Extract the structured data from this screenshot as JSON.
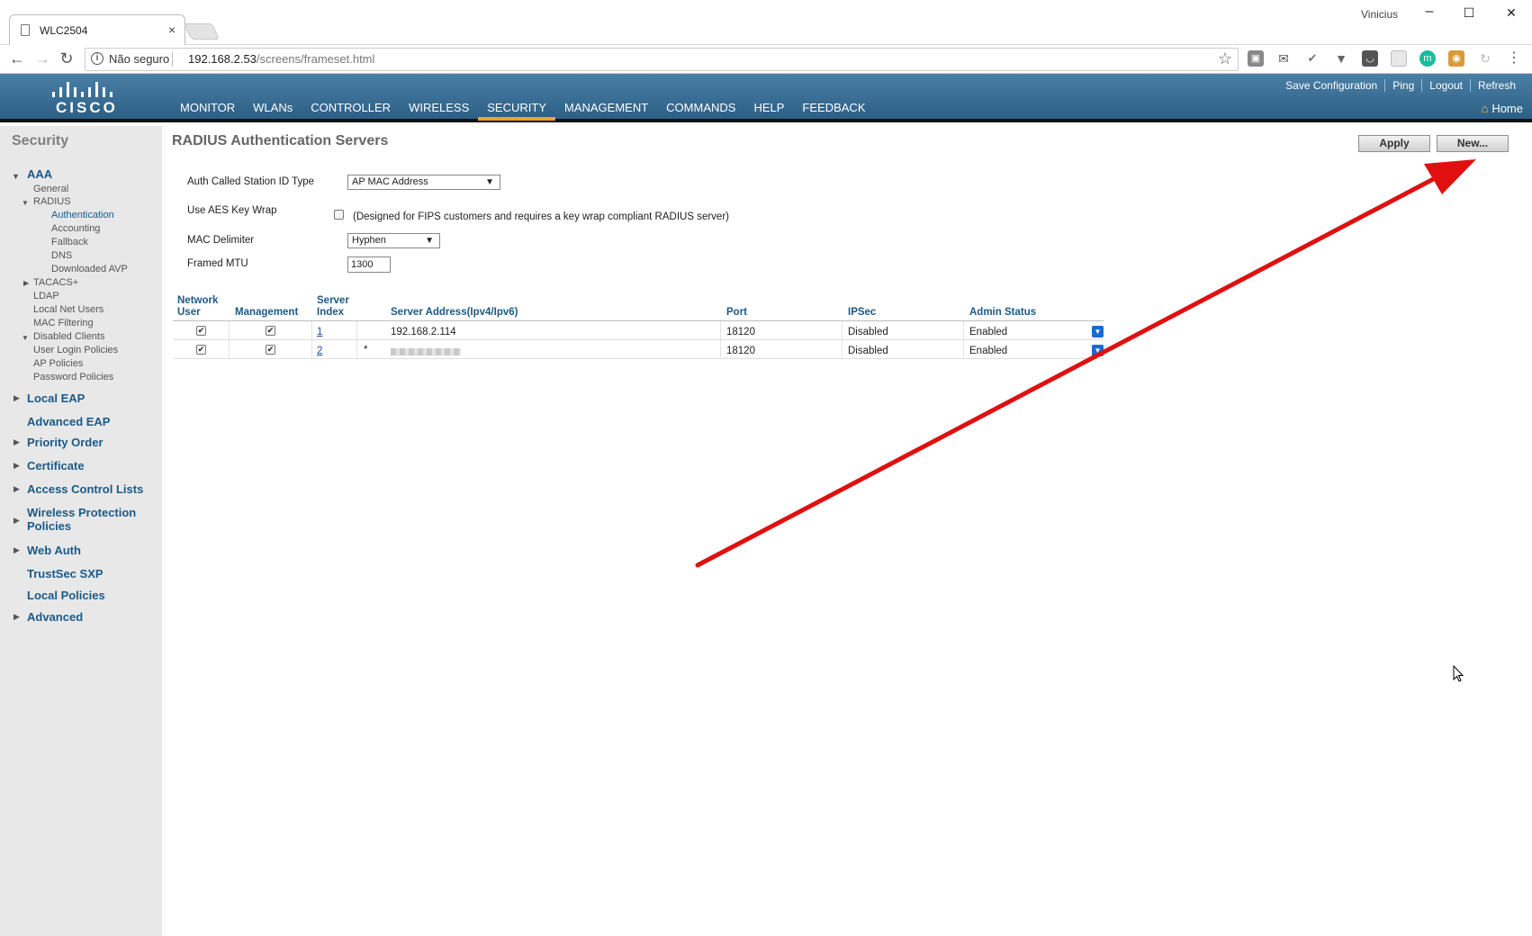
{
  "browser": {
    "tab_title": "WLC2504",
    "tab_close": "×",
    "window_user": "Vinicius",
    "window_controls": [
      "–",
      "☐",
      "✕"
    ],
    "address": {
      "security_label": "Não seguro",
      "url_host": "192.168.2.53",
      "url_path": "/screens/frameset.html"
    },
    "nav_icons": [
      "back-arrow-icon",
      "forward-arrow-icon",
      "reload-icon"
    ]
  },
  "header": {
    "logo_text": "CISCO",
    "nav": [
      "MONITOR",
      "WLANs",
      "CONTROLLER",
      "WIRELESS",
      "SECURITY",
      "MANAGEMENT",
      "COMMANDS",
      "HELP",
      "FEEDBACK"
    ],
    "active_nav": "SECURITY",
    "top_links": [
      "Save Configuration",
      "Ping",
      "Logout",
      "Refresh"
    ],
    "home": "Home",
    "colors": {
      "bar": "#2c5f86",
      "active_underline": "#f0a030"
    }
  },
  "sidebar": {
    "title": "Security",
    "aaa": "AAA",
    "aaa_items": {
      "general": "General",
      "radius": "RADIUS",
      "radius_items": [
        "Authentication",
        "Accounting",
        "Fallback",
        "DNS",
        "Downloaded AVP"
      ],
      "tacacs": "TACACS+",
      "ldap": "LDAP",
      "local_net_users": "Local Net Users",
      "mac_filtering": "MAC Filtering",
      "disabled_clients": "Disabled Clients",
      "user_login_policies": "User Login Policies",
      "ap_policies": "AP Policies",
      "password_policies": "Password Policies"
    },
    "groups": [
      "Local EAP",
      "Advanced EAP",
      "Priority Order",
      "Certificate",
      "Access Control Lists",
      "Wireless Protection",
      "Policies",
      "Web Auth",
      "TrustSec SXP",
      "Local Policies",
      "Advanced"
    ]
  },
  "main": {
    "title": "RADIUS Authentication Servers",
    "apply_button": "Apply",
    "new_button": "New...",
    "form": {
      "station_id_label": "Auth Called Station ID Type",
      "station_id_value": "AP MAC Address",
      "aes_label": "Use AES Key Wrap",
      "aes_checked": false,
      "aes_note": "(Designed for FIPS customers and requires a key wrap compliant RADIUS server)",
      "mac_delim_label": "MAC Delimiter",
      "mac_delim_value": "Hyphen",
      "mtu_label": "Framed MTU",
      "mtu_value": "1300"
    },
    "table": {
      "headers": {
        "network_user_1": "Network",
        "network_user_2": "User",
        "management": "Management",
        "server_index_1": "Server",
        "server_index_2": "Index",
        "address": "Server Address(Ipv4/Ipv6)",
        "port": "Port",
        "ipsec": "IPSec",
        "admin_status": "Admin Status"
      },
      "rows": [
        {
          "network_user": true,
          "management": true,
          "index": "1",
          "flag": "",
          "address": "192.168.2.114",
          "port": "18120",
          "ipsec": "Disabled",
          "status": "Enabled"
        },
        {
          "network_user": true,
          "management": true,
          "index": "2",
          "flag": "*",
          "address": "",
          "port": "18120",
          "ipsec": "Disabled",
          "status": "Enabled"
        }
      ]
    },
    "annotation_color": "#e01010"
  }
}
